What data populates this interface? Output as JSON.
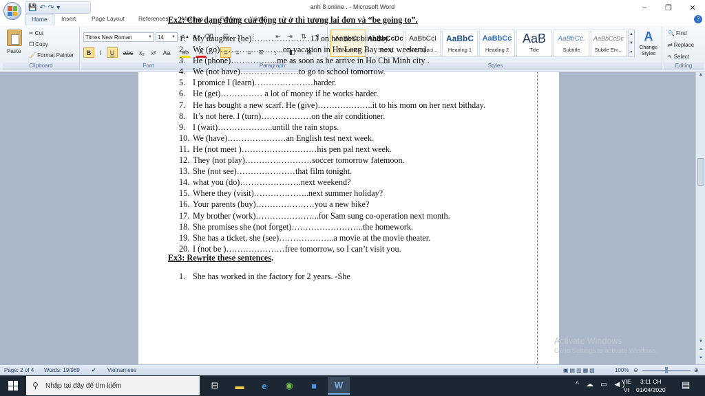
{
  "window": {
    "title": "anh 8 online . - Microsoft Word",
    "minimize": "–",
    "maximize": "❐",
    "close": "✕"
  },
  "qat": {
    "undo": "↶",
    "redo": "↷",
    "save": "💾",
    "more": "▾"
  },
  "tabs": [
    "Home",
    "Insert",
    "Page Layout",
    "References",
    "Mailings",
    "Review",
    "View"
  ],
  "ribbon": {
    "clipboard": {
      "paste": "Paste",
      "cut": "Cut",
      "copy": "Copy",
      "format_painter": "Format Painter",
      "label": "Clipboard"
    },
    "font": {
      "family": "Times New Roman",
      "size": "14",
      "label": "Font"
    },
    "paragraph": {
      "label": "Paragraph"
    },
    "styles": {
      "label": "Styles",
      "items": [
        {
          "sample": "AaBbCcI",
          "name": "¶ Normal"
        },
        {
          "sample": "AaBbCcDc",
          "name": "Strong"
        },
        {
          "sample": "AaBbCcI",
          "name": "¶ No Spaci..."
        },
        {
          "sample": "AaBbC",
          "name": "Heading 1"
        },
        {
          "sample": "AaBbCc",
          "name": "Heading 2"
        },
        {
          "sample": "AaB",
          "name": "Title"
        },
        {
          "sample": "AaBbCc.",
          "name": "Subtitle"
        },
        {
          "sample": "AaBbCcDc",
          "name": "Subtle Em..."
        }
      ],
      "change_styles": "Change Styles"
    },
    "editing": {
      "find": "Find",
      "replace": "Replace",
      "select": "Select",
      "label": "Editing"
    }
  },
  "document": {
    "ex2_heading": "Ex2: Cho dạng đúng của động từ ở thì tương lai đơn và “be going to”.",
    "ex2_items": [
      "My daughter (be)…………………13 on her next birthday.",
      "We (go)…………………..on vacation in Ha Long Bay next weekend.",
      "He (phone)……………..me as soon as he arrive  in Ho Chi Minh city .",
      "We (not have)…………………to go to school tomorrow.",
      "I promice I (learn)…………………harder.",
      "He (get)…………… a lot of money if he works harder.",
      "He has bought a new scarf.  He (give)………………..it to his mom on her next bithday.",
      "It’s not here. I (turn)………………on the air conditioner.",
      "I (wait)………………..untill the rain stops.",
      "We (have)…………………an English test next week.",
      "He (not meet )………………………his pen pal next week.",
      "They (not play)……………………soccer tomorrow fatemoon.",
      "She (not see)…………………that film tonight.",
      "what you (do)………………….next weekend?",
      "Where they (visit)………………..next summer holiday?",
      "Your parents (buy)…………………you a new bike?",
      "My brother (work)…………………..for Sam sung co-operation next month.",
      "She promises she (not forget)……………………..the homework.",
      "She has a ticket, she (see)………………..a movie at the movie theater.",
      "I (not be )…………………free tomorrow, so I can’t visit you."
    ],
    "ex3_heading": "Ex3: Rewrite these sentences",
    "ex3_heading_tail": ".",
    "ex3_items": [
      "She has worked in the factory for 2 years.               -She"
    ]
  },
  "watermark": {
    "line1": "Activate Windows",
    "line2": "Go to Settings to activate Windows."
  },
  "status": {
    "page": "Page: 2 of 4",
    "words": "Words: 19/989",
    "language": "Vietnamese",
    "zoom": "100%"
  },
  "taskbar": {
    "search_placeholder": "Nhập tại đây để tìm kiếm",
    "lang_top": "VIE",
    "lang_bottom": "VI",
    "time": "3:11 CH",
    "date": "01/04/2020"
  }
}
